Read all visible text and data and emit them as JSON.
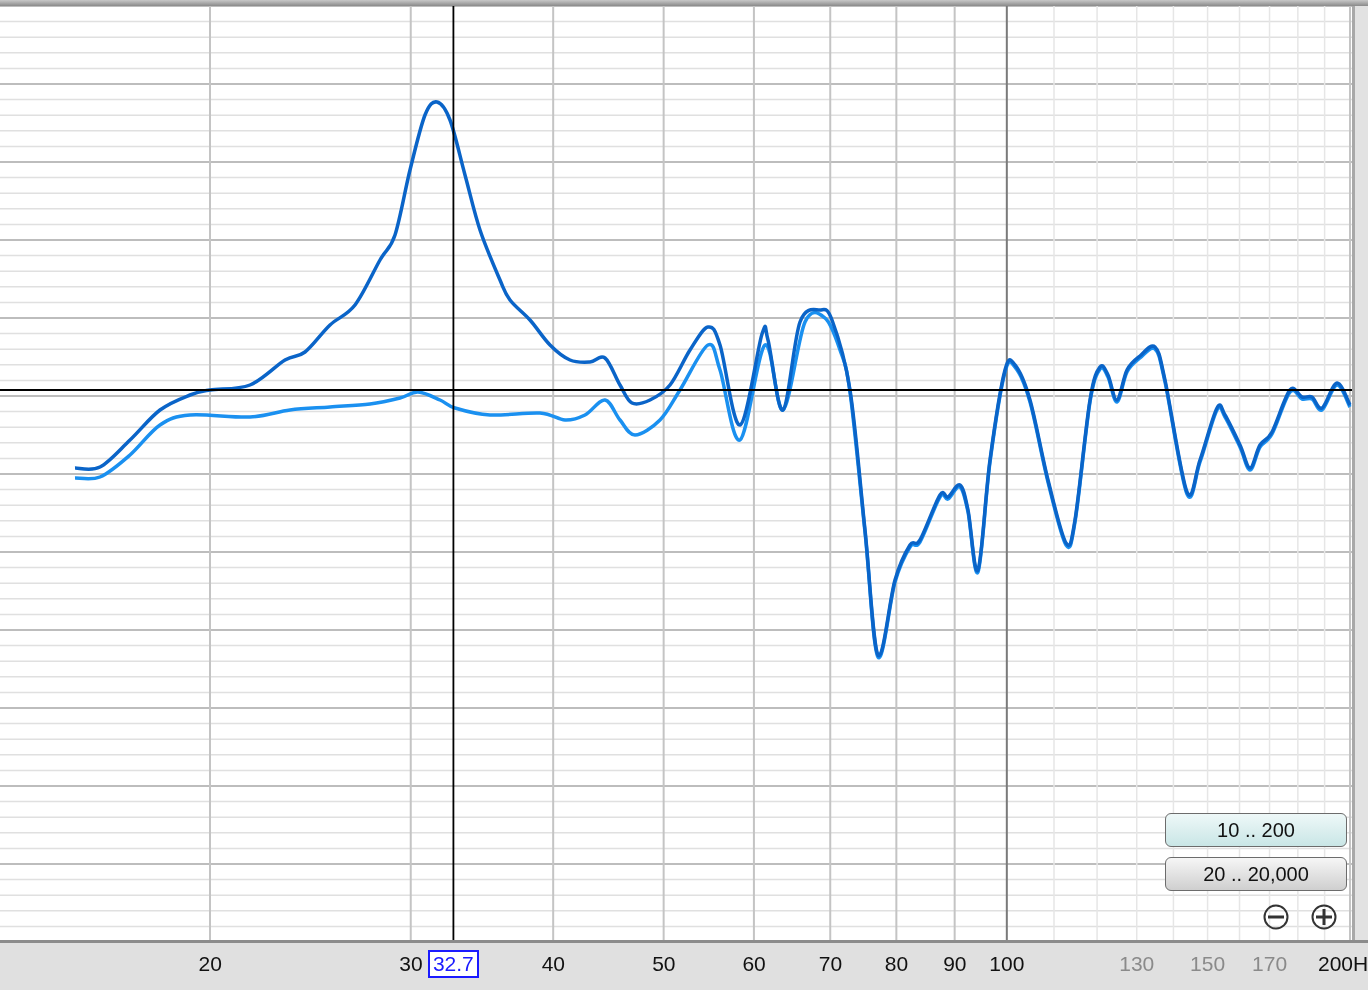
{
  "plot": {
    "cursor": {
      "reading": "32.7"
    }
  },
  "range_buttons": [
    {
      "label": "10 .. 200",
      "selected": true
    },
    {
      "label": "20 .. 20,000",
      "selected": false
    }
  ],
  "zoom_buttons": [
    {
      "kind": "zoom_out"
    },
    {
      "kind": "zoom_in"
    }
  ],
  "x_axis": {
    "labels": [
      {
        "label": "20",
        "dimmed": false
      },
      {
        "label": "30",
        "dimmed": false
      },
      {
        "label": "40",
        "dimmed": false
      },
      {
        "label": "50",
        "dimmed": false
      },
      {
        "label": "60",
        "dimmed": false
      },
      {
        "label": "70",
        "dimmed": false
      },
      {
        "label": "80",
        "dimmed": false
      },
      {
        "label": "90",
        "dimmed": false
      },
      {
        "label": "100",
        "dimmed": false
      },
      {
        "label": "130",
        "dimmed": true
      },
      {
        "label": "150",
        "dimmed": true
      },
      {
        "label": "170",
        "dimmed": true
      },
      {
        "label": "200H",
        "dimmed": false
      }
    ]
  }
}
